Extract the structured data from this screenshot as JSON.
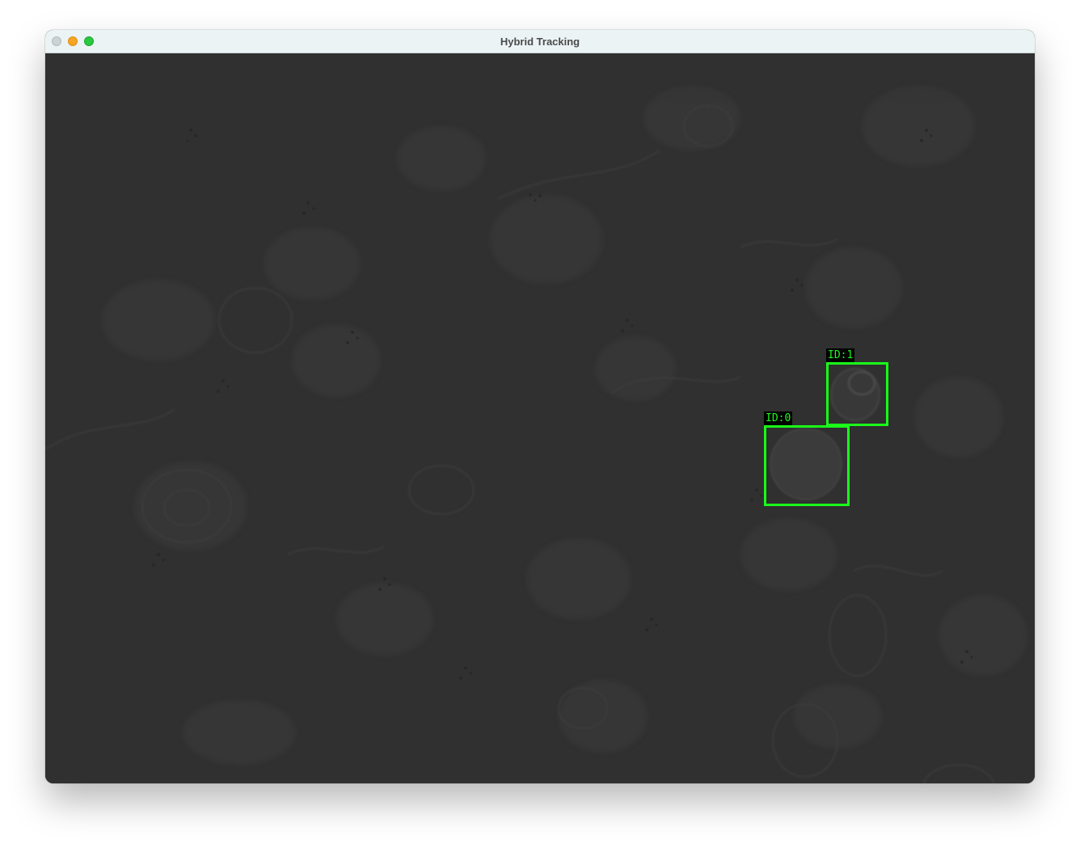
{
  "window": {
    "title": "Hybrid Tracking"
  },
  "tracks": [
    {
      "id": 0,
      "label": "ID:0"
    },
    {
      "id": 1,
      "label": "ID:1"
    }
  ],
  "colors": {
    "box": "#19ff19",
    "label_bg": "#000000",
    "background": "#303030"
  }
}
